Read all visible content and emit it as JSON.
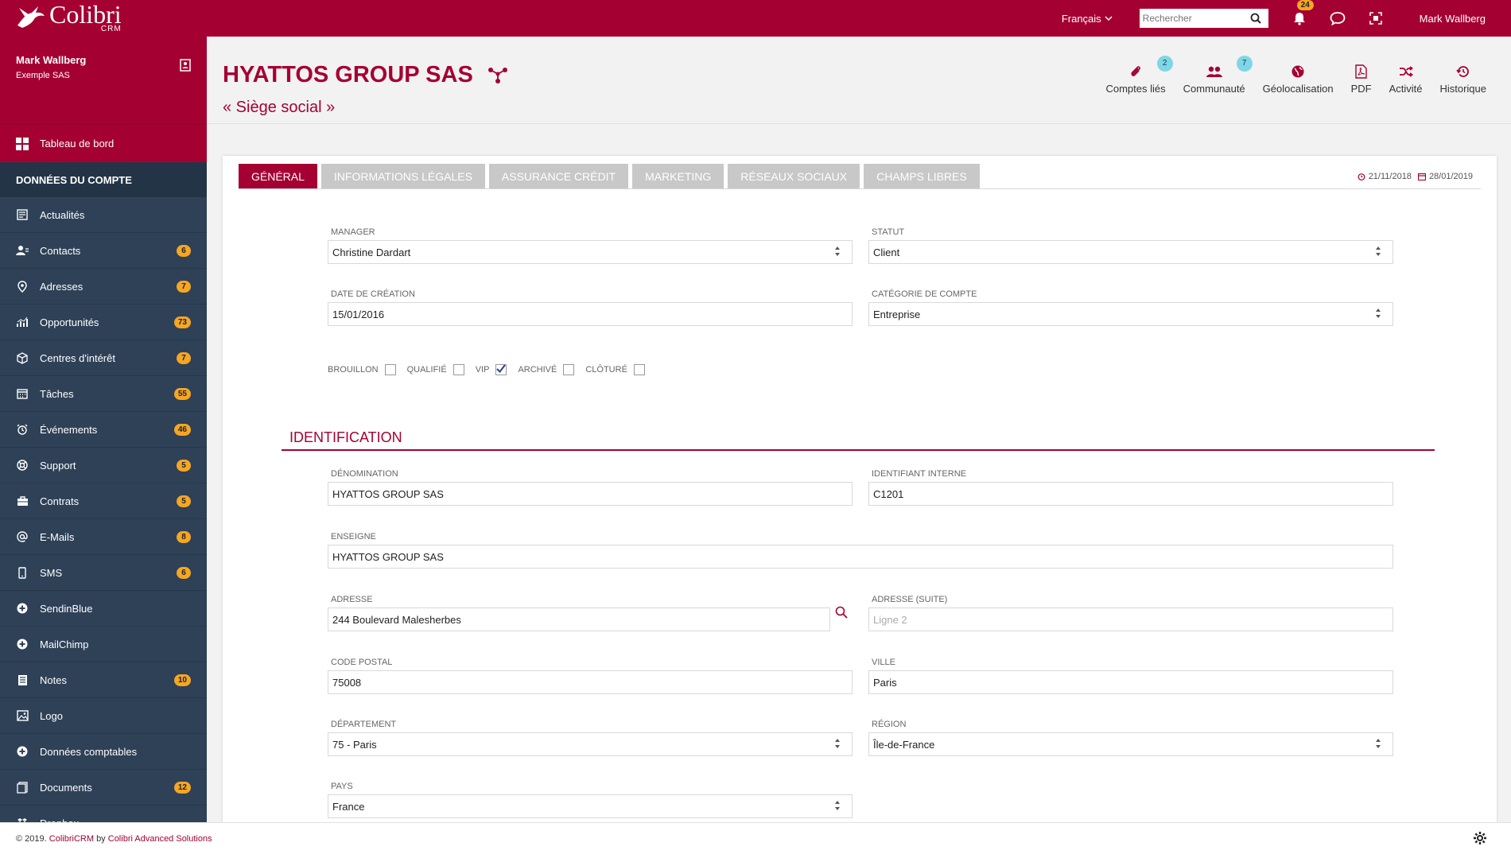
{
  "app": {
    "brand": "Colibri",
    "brand_sub": "CRM"
  },
  "topbar": {
    "language": "Français",
    "search_placeholder": "Rechercher",
    "notifications_count": "24",
    "user": "Mark Wallberg"
  },
  "sidebar": {
    "user_name": "Mark Wallberg",
    "company": "Exemple SAS",
    "dashboard": "Tableau de bord",
    "section": "DONNÉES DU COMPTE",
    "items": [
      {
        "label": "Actualités",
        "icon": "newspaper-icon",
        "count": ""
      },
      {
        "label": "Contacts",
        "icon": "contact-icon",
        "count": "6"
      },
      {
        "label": "Adresses",
        "icon": "map-pin-icon",
        "count": "7"
      },
      {
        "label": "Opportunités",
        "icon": "chart-icon",
        "count": "73"
      },
      {
        "label": "Centres d'intérêt",
        "icon": "cube-icon",
        "count": "7"
      },
      {
        "label": "Tâches",
        "icon": "calendar-icon",
        "count": "55"
      },
      {
        "label": "Événements",
        "icon": "alarm-icon",
        "count": "46"
      },
      {
        "label": "Support",
        "icon": "lifebuoy-icon",
        "count": "5"
      },
      {
        "label": "Contrats",
        "icon": "briefcase-icon",
        "count": "5"
      },
      {
        "label": "E-Mails",
        "icon": "at-icon",
        "count": "8"
      },
      {
        "label": "SMS",
        "icon": "mobile-icon",
        "count": "6"
      },
      {
        "label": "SendinBlue",
        "icon": "plus-circle-icon",
        "count": ""
      },
      {
        "label": "MailChimp",
        "icon": "plus-circle-icon",
        "count": ""
      },
      {
        "label": "Notes",
        "icon": "notes-icon",
        "count": "10"
      },
      {
        "label": "Logo",
        "icon": "image-icon",
        "count": ""
      },
      {
        "label": "Données comptables",
        "icon": "plus-circle-icon",
        "count": ""
      },
      {
        "label": "Documents",
        "icon": "documents-icon",
        "count": "12"
      },
      {
        "label": "Dropbox",
        "icon": "dropbox-icon",
        "count": ""
      }
    ]
  },
  "header": {
    "title": "HYATTOS GROUP SAS",
    "subtitle": "« Siège social »",
    "actions": [
      {
        "label": "Comptes liés",
        "icon": "paperclip-icon",
        "count": "2"
      },
      {
        "label": "Communauté",
        "icon": "users-icon",
        "count": "7"
      },
      {
        "label": "Géolocalisation",
        "icon": "globe-icon",
        "count": ""
      },
      {
        "label": "PDF",
        "icon": "pdf-icon",
        "count": ""
      },
      {
        "label": "Activité",
        "icon": "shuffle-icon",
        "count": ""
      },
      {
        "label": "Historique",
        "icon": "history-icon",
        "count": ""
      }
    ]
  },
  "tabs": [
    "GÉNÉRAL",
    "INFORMATIONS LÉGALES",
    "ASSURANCE CRÉDIT",
    "MARKETING",
    "RÉSEAUX SOCIAUX",
    "CHAMPS LIBRES"
  ],
  "dates": {
    "created": "21/11/2018",
    "updated": "28/01/2019"
  },
  "general": {
    "manager_label": "MANAGER",
    "manager": "Christine Dardart",
    "statut_label": "STATUT",
    "statut": "Client",
    "date_label": "DATE DE CRÉATION",
    "date": "15/01/2016",
    "categorie_label": "CATÉGORIE DE COMPTE",
    "categorie": "Entreprise",
    "flags": [
      {
        "label": "BROUILLON",
        "checked": false
      },
      {
        "label": "QUALIFIÉ",
        "checked": false
      },
      {
        "label": "VIP",
        "checked": true
      },
      {
        "label": "ARCHIVÉ",
        "checked": false
      },
      {
        "label": "CLÔTURÉ",
        "checked": false
      }
    ]
  },
  "identification": {
    "title": "IDENTIFICATION",
    "denomination_label": "DÉNOMINATION",
    "denomination": "HYATTOS GROUP SAS",
    "identifiant_label": "IDENTIFIANT INTERNE",
    "identifiant": "C1201",
    "enseigne_label": "ENSEIGNE",
    "enseigne": "HYATTOS GROUP SAS",
    "adresse_label": "ADRESSE",
    "adresse": "244 Boulevard Malesherbes",
    "adresse2_label": "ADRESSE (SUITE)",
    "adresse2_placeholder": "Ligne 2",
    "cp_label": "CODE POSTAL",
    "cp": "75008",
    "ville_label": "VILLE",
    "ville": "Paris",
    "departement_label": "DÉPARTEMENT",
    "departement": "75 - Paris",
    "region_label": "RÉGION",
    "region": "Île-de-France",
    "pays_label": "PAYS",
    "pays": "France"
  },
  "footer": {
    "copyright": "© 2019.",
    "product": "ColibriCRM",
    "by": "by",
    "company": "Colibri Advanced Solutions"
  },
  "colors": {
    "brand": "#a50032",
    "sidebar": "#2e4157",
    "badge": "#f5a623",
    "badge_cyan": "#7fd6e6"
  }
}
